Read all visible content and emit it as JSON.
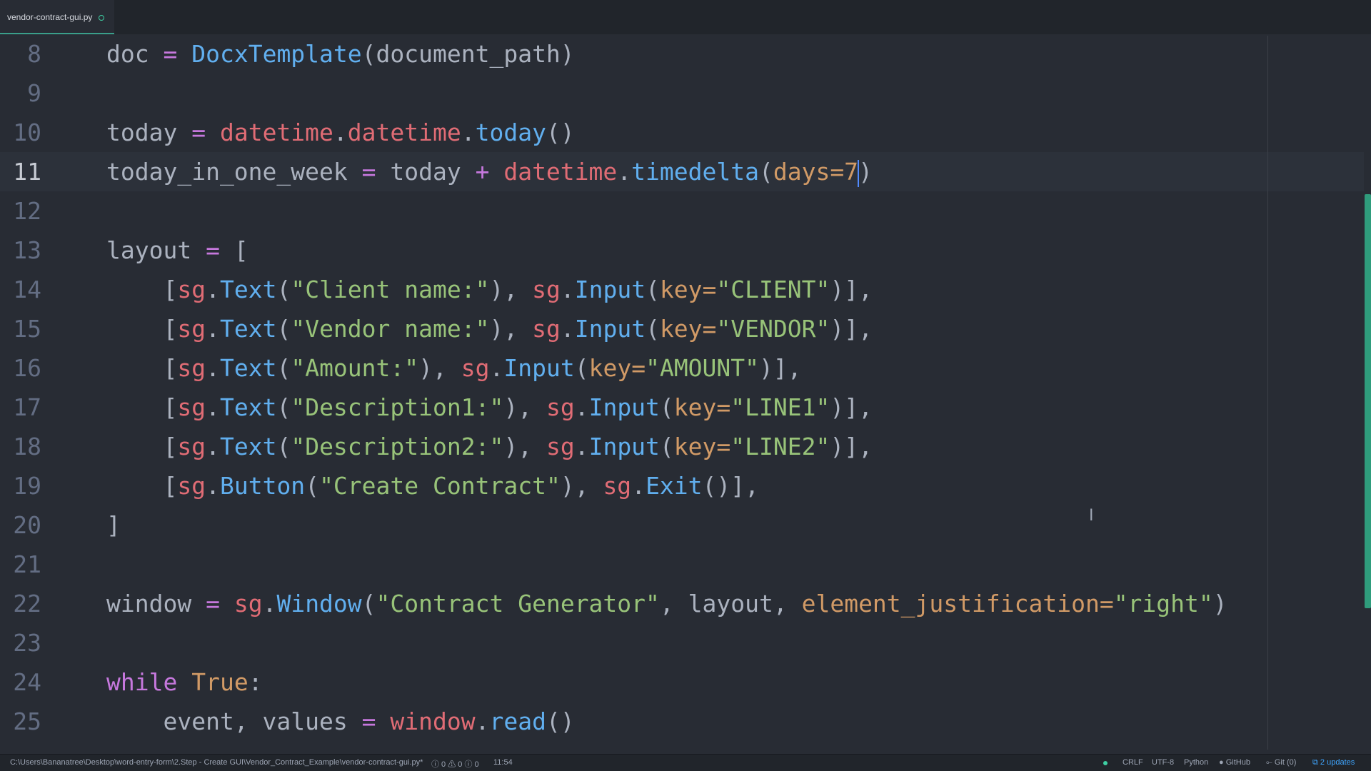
{
  "tab": {
    "title": "vendor-contract-gui.py"
  },
  "lines": [
    {
      "num": "8"
    },
    {
      "num": "9"
    },
    {
      "num": "10"
    },
    {
      "num": "11"
    },
    {
      "num": "12"
    },
    {
      "num": "13"
    },
    {
      "num": "14"
    },
    {
      "num": "15"
    },
    {
      "num": "16"
    },
    {
      "num": "17"
    },
    {
      "num": "18"
    },
    {
      "num": "19"
    },
    {
      "num": "20"
    },
    {
      "num": "21"
    },
    {
      "num": "22"
    },
    {
      "num": "23"
    },
    {
      "num": "24"
    },
    {
      "num": "25"
    }
  ],
  "code": {
    "l8": [
      "doc ",
      "=",
      " ",
      "DocxTemplate",
      "(document_path)"
    ],
    "l10": [
      "today ",
      "=",
      " ",
      "datetime",
      ".",
      "datetime",
      ".",
      "today",
      "()"
    ],
    "l11": [
      "today_in_one_week ",
      "=",
      " today ",
      "+",
      " ",
      "datetime",
      ".",
      "timedelta",
      "(",
      "days=7",
      ")"
    ],
    "l13": [
      "layout ",
      "=",
      " ["
    ],
    "l14": [
      "    [",
      "sg",
      ".",
      "Text",
      "(",
      "\"Client name:\"",
      "), ",
      "sg",
      ".",
      "Input",
      "(",
      "key=",
      "\"CLIENT\"",
      ")],"
    ],
    "l15": [
      "    [",
      "sg",
      ".",
      "Text",
      "(",
      "\"Vendor name:\"",
      "), ",
      "sg",
      ".",
      "Input",
      "(",
      "key=",
      "\"VENDOR\"",
      ")],"
    ],
    "l16": [
      "    [",
      "sg",
      ".",
      "Text",
      "(",
      "\"Amount:\"",
      "), ",
      "sg",
      ".",
      "Input",
      "(",
      "key=",
      "\"AMOUNT\"",
      ")],"
    ],
    "l17": [
      "    [",
      "sg",
      ".",
      "Text",
      "(",
      "\"Description1:\"",
      "), ",
      "sg",
      ".",
      "Input",
      "(",
      "key=",
      "\"LINE1\"",
      ")],"
    ],
    "l18": [
      "    [",
      "sg",
      ".",
      "Text",
      "(",
      "\"Description2:\"",
      "), ",
      "sg",
      ".",
      "Input",
      "(",
      "key=",
      "\"LINE2\"",
      ")],"
    ],
    "l19": [
      "    [",
      "sg",
      ".",
      "Button",
      "(",
      "\"Create Contract\"",
      "), ",
      "sg",
      ".",
      "Exit",
      "()],"
    ],
    "l20": [
      "]"
    ],
    "l22": [
      "window ",
      "=",
      " ",
      "sg",
      ".",
      "Window",
      "(",
      "\"Contract Generator\"",
      ", layout, ",
      "element_justification=",
      "\"right\"",
      ")"
    ],
    "l24": [
      "while",
      " ",
      "True",
      ":"
    ],
    "l25": [
      "    event, values ",
      "=",
      " ",
      "window",
      ".",
      "read",
      "()"
    ]
  },
  "status": {
    "path": "C:\\Users\\Bananatree\\Desktop\\word-entry-form\\2.Step - Create GUI\\Vendor_Contract_Example\\vendor-contract-gui.py*",
    "diagnostics": "ⓘ 0 ⚠ 0 ⓘ 0",
    "cursor_pos": "11:54",
    "line_ending": "CRLF",
    "encoding": "UTF-8",
    "grammar": "Python",
    "github": "GitHub",
    "git": "Git (0)",
    "updates": "2 updates"
  },
  "colors": {
    "background": "#282c34",
    "keyword": "#c678dd",
    "function": "#61afef",
    "string": "#98c379",
    "object": "#e06c75",
    "number": "#d19a66",
    "accent": "#3ecfa3"
  }
}
